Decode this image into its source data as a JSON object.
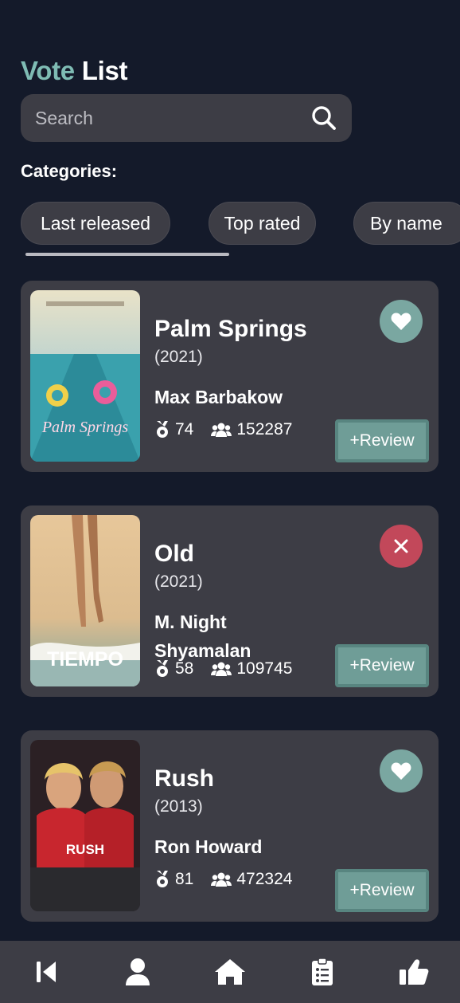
{
  "header": {
    "title_accent": "Vote",
    "title_rest": "List"
  },
  "search": {
    "placeholder": "Search",
    "value": ""
  },
  "categories": {
    "label": "Categories:",
    "tabs": [
      {
        "label": "Last released",
        "active": true
      },
      {
        "label": "Top rated",
        "active": false
      },
      {
        "label": "By name",
        "active": false
      }
    ]
  },
  "movies": [
    {
      "title": "Palm Springs",
      "year": "(2021)",
      "director": "Max Barbakow",
      "score": "74",
      "votes": "152287",
      "review_label": "+Review",
      "favorite_state": "liked",
      "poster_caption": "Palm Springs"
    },
    {
      "title": "Old",
      "year": "(2021)",
      "director": "M. Night Shyamalan",
      "score": "58",
      "votes": "109745",
      "review_label": "+Review",
      "favorite_state": "removed",
      "poster_caption": "TIEMPO"
    },
    {
      "title": "Rush",
      "year": "(2013)",
      "director": "Ron Howard",
      "score": "81",
      "votes": "472324",
      "review_label": "+Review",
      "favorite_state": "liked",
      "poster_caption": "RUSH"
    }
  ],
  "nav": {
    "items": [
      {
        "icon": "back-icon"
      },
      {
        "icon": "user-icon"
      },
      {
        "icon": "home-icon"
      },
      {
        "icon": "clipboard-list-icon"
      },
      {
        "icon": "thumbs-up-icon"
      }
    ]
  },
  "colors": {
    "background": "#141a2a",
    "card": "#3d3d45",
    "accent": "#7fbcb4",
    "like_button": "#7aa7a1",
    "remove_button": "#c2485a",
    "review_button": "#6f9d97"
  }
}
